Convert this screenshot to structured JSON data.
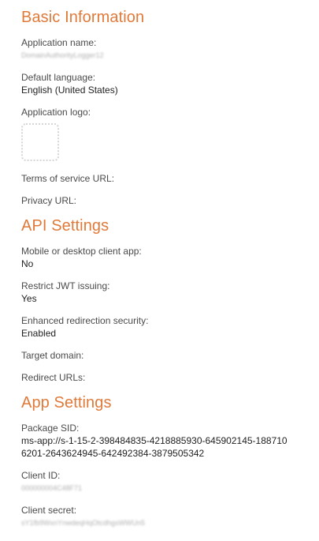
{
  "sections": {
    "basic": {
      "title": "Basic Information",
      "fields": [
        {
          "label": "Application name:",
          "value": "DomainAuthorityLogger12"
        },
        {
          "label": "Default language:",
          "value": "English (United States)"
        },
        {
          "label": "Application logo:"
        },
        {
          "label": "Terms of service URL:"
        },
        {
          "label": "Privacy URL:"
        }
      ]
    },
    "api": {
      "title": "API Settings",
      "fields": [
        {
          "label": "Mobile or desktop client app:",
          "value": "No"
        },
        {
          "label": "Restrict JWT issuing:",
          "value": "Yes"
        },
        {
          "label": "Enhanced redirection security:",
          "value": "Enabled"
        },
        {
          "label": "Target domain:"
        },
        {
          "label": "Redirect URLs:"
        }
      ]
    },
    "app": {
      "title": "App Settings",
      "fields": [
        {
          "label": "Package SID:",
          "value": "ms-app://s-1-15-2-398484835-4218885930-645902145-1887106201-2643624945-642492384-3879505342"
        },
        {
          "label": "Client ID:",
          "value": "000000004C48F71"
        },
        {
          "label": "Client secret:",
          "value": "sY1fb9WxnYnwdeqHqOtcdhgsWWUn5"
        }
      ]
    }
  }
}
